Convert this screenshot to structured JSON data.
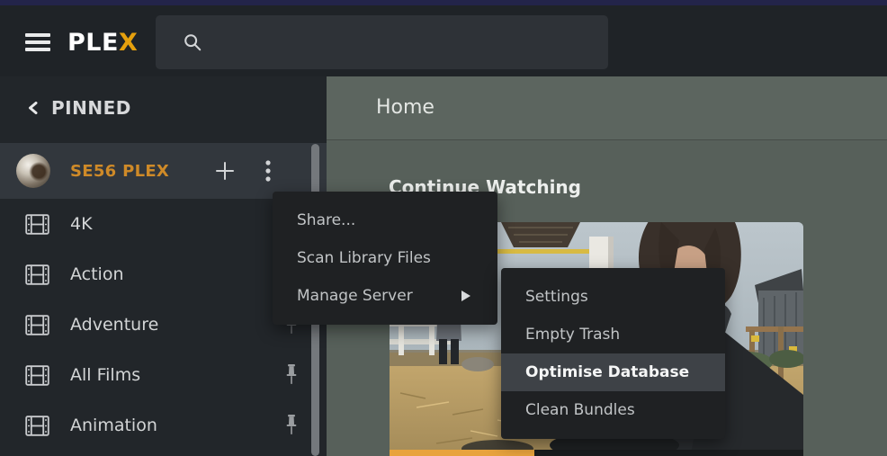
{
  "topbar": {
    "logo_text": "PLE",
    "logo_accent": "X",
    "search_value": "",
    "search_placeholder": ""
  },
  "sidebar": {
    "back_label": "PINNED",
    "server": {
      "name": "SE56 PLEX"
    },
    "items": [
      {
        "label": "4K",
        "pinned": false
      },
      {
        "label": "Action",
        "pinned": false
      },
      {
        "label": "Adventure",
        "pinned": true
      },
      {
        "label": "All Films",
        "pinned": true
      },
      {
        "label": "Animation",
        "pinned": true
      }
    ]
  },
  "main": {
    "title": "Home",
    "section_title": "Continue Watching",
    "progress_percent": 35
  },
  "context_menu": {
    "items": [
      {
        "label": "Share..."
      },
      {
        "label": "Scan Library Files"
      },
      {
        "label": "Manage Server",
        "has_submenu": true
      }
    ]
  },
  "submenu": {
    "items": [
      {
        "label": "Settings"
      },
      {
        "label": "Empty Trash"
      },
      {
        "label": "Optimise Database",
        "highlighted": true
      },
      {
        "label": "Clean Bundles"
      }
    ]
  },
  "colors": {
    "accent": "#e5a00d",
    "server_name": "#cf8a28",
    "progress_fill": "#e8a33d",
    "menu_highlight": "#3e4247",
    "backdrop": "#57605a"
  }
}
